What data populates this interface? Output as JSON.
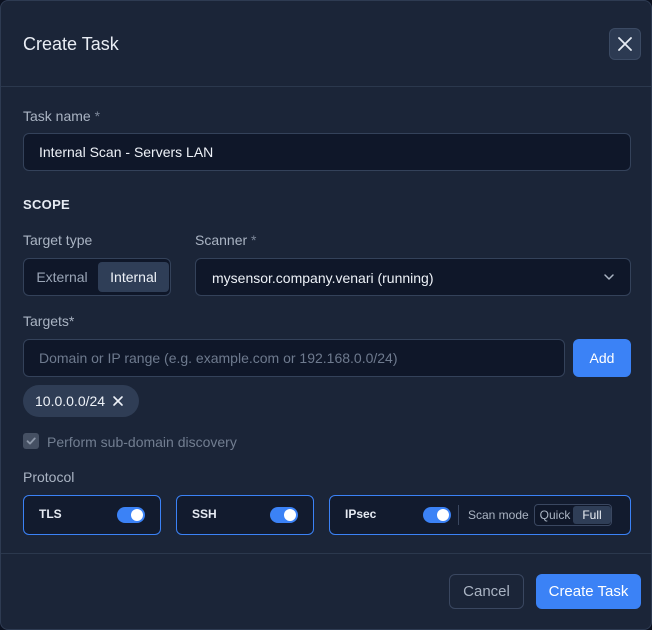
{
  "modal": {
    "title": "Create Task"
  },
  "task_name": {
    "label": "Task name",
    "required_mark": "*",
    "value": "Internal Scan - Servers LAN"
  },
  "scope": {
    "section_title": "SCOPE",
    "target_type": {
      "label": "Target type",
      "options": [
        "External",
        "Internal"
      ],
      "selected": "Internal"
    },
    "scanner": {
      "label": "Scanner",
      "required_mark": "*",
      "value": "mysensor.company.venari (running)"
    },
    "targets": {
      "label": "Targets*",
      "placeholder": "Domain or IP range (e.g. example.com or 192.168.0.0/24)",
      "add_label": "Add",
      "chips": [
        "10.0.0.0/24"
      ]
    },
    "subdomain_discovery": {
      "label": "Perform sub-domain discovery",
      "checked": true
    }
  },
  "protocol": {
    "label": "Protocol",
    "items": [
      {
        "name": "TLS",
        "enabled": true
      },
      {
        "name": "SSH",
        "enabled": true
      },
      {
        "name": "IPsec",
        "enabled": true
      }
    ],
    "scan_mode": {
      "label": "Scan mode",
      "options": [
        "Quick",
        "Full"
      ],
      "selected": "Full"
    }
  },
  "footer": {
    "cancel_label": "Cancel",
    "create_label": "Create Task"
  },
  "colors": {
    "accent": "#3b82f6",
    "background": "#1b2538",
    "input_bg": "#0f1729"
  },
  "icons": {
    "close": "close-icon",
    "chevron": "chevron-down-icon",
    "chip_remove": "close-icon",
    "check": "check-icon"
  }
}
